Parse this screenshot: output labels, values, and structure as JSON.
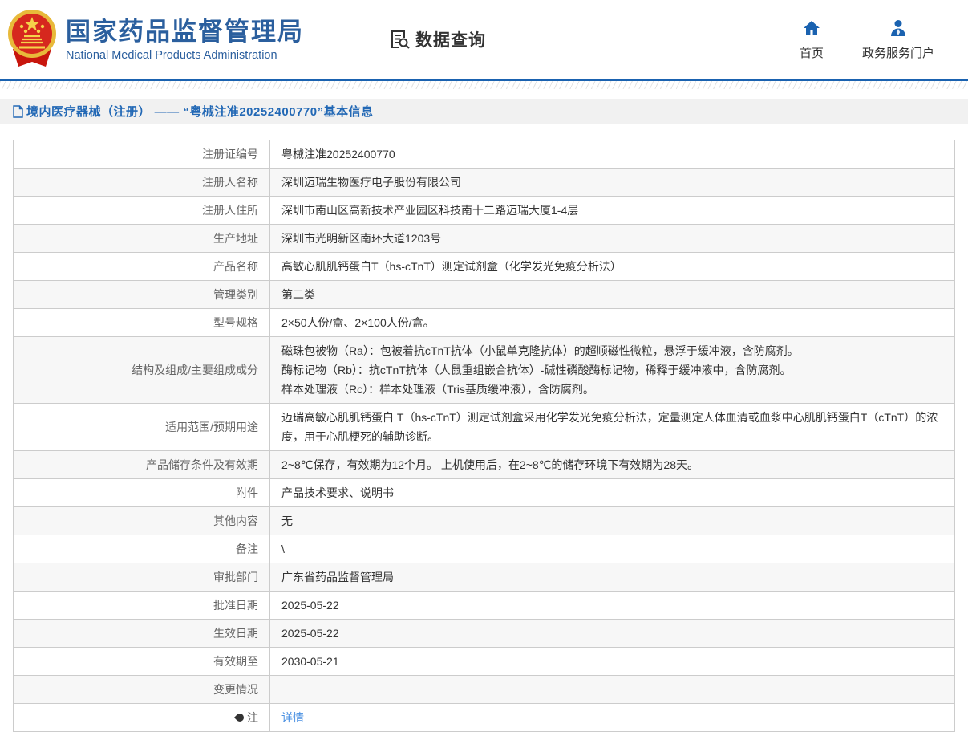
{
  "colors": {
    "brand_blue": "#2b5f9e",
    "nav_icon_blue": "#1a62b0",
    "divider_blue": "#1a62b0",
    "breadcrumb_bg": "#f1f1f1",
    "breadcrumb_text": "#2268b5",
    "table_border": "#cccccc",
    "zebra_row": "#f7f7f7",
    "label_text": "#666666",
    "value_text": "#333333",
    "link_blue": "#4a90e2",
    "emblem_red": "#d6281e",
    "emblem_gold": "#e8b93a"
  },
  "header": {
    "org_title_cn": "国家药品监督管理局",
    "org_title_en": "National Medical Products Administration",
    "section_label": "数据查询",
    "nav": [
      {
        "icon": "home-icon",
        "label": "首页"
      },
      {
        "icon": "user-icon",
        "label": "政务服务门户"
      }
    ]
  },
  "breadcrumb": {
    "icon": "document-icon",
    "text": "境内医疗器械（注册） —— “粤械注准20252400770”基本信息"
  },
  "table": {
    "rows": [
      {
        "label": "注册证编号",
        "value": "粤械注准20252400770"
      },
      {
        "label": "注册人名称",
        "value": "深圳迈瑞生物医疗电子股份有限公司"
      },
      {
        "label": "注册人住所",
        "value": "深圳市南山区高新技术产业园区科技南十二路迈瑞大厦1-4层"
      },
      {
        "label": "生产地址",
        "value": "深圳市光明新区南环大道1203号"
      },
      {
        "label": "产品名称",
        "value": "高敏心肌肌钙蛋白T（hs-cTnT）测定试剂盒（化学发光免疫分析法）"
      },
      {
        "label": "管理类别",
        "value": "第二类"
      },
      {
        "label": "型号规格",
        "value": "2×50人份/盒、2×100人份/盒。"
      },
      {
        "label": "结构及组成/主要组成成分",
        "lines": [
          "磁珠包被物（Ra）：包被着抗cTnT抗体（小鼠单克隆抗体）的超顺磁性微粒，悬浮于缓冲液，含防腐剂。",
          "酶标记物（Rb）：抗cTnT抗体（人鼠重组嵌合抗体）-碱性磷酸酶标记物，稀释于缓冲液中，含防腐剂。",
          "样本处理液（Rc）：样本处理液（Tris基质缓冲液），含防腐剂。"
        ]
      },
      {
        "label": "适用范围/预期用途",
        "value": "迈瑞高敏心肌肌钙蛋白 T（hs-cTnT）测定试剂盒采用化学发光免疫分析法，定量测定人体血清或血浆中心肌肌钙蛋白T（cTnT）的浓度，用于心肌梗死的辅助诊断。"
      },
      {
        "label": "产品储存条件及有效期",
        "value": "2~8℃保存，有效期为12个月。 上机使用后，在2~8℃的储存环境下有效期为28天。"
      },
      {
        "label": "附件",
        "value": "产品技术要求、说明书"
      },
      {
        "label": "其他内容",
        "value": "无"
      },
      {
        "label": "备注",
        "value": "\\"
      },
      {
        "label": "审批部门",
        "value": "广东省药品监督管理局"
      },
      {
        "label": "批准日期",
        "value": "2025-05-22"
      },
      {
        "label": "生效日期",
        "value": "2025-05-22"
      },
      {
        "label": "有效期至",
        "value": "2030-05-21"
      },
      {
        "label": "变更情况",
        "value": ""
      },
      {
        "label": "注",
        "label_icon": "note-icon",
        "link": "详情"
      }
    ]
  }
}
